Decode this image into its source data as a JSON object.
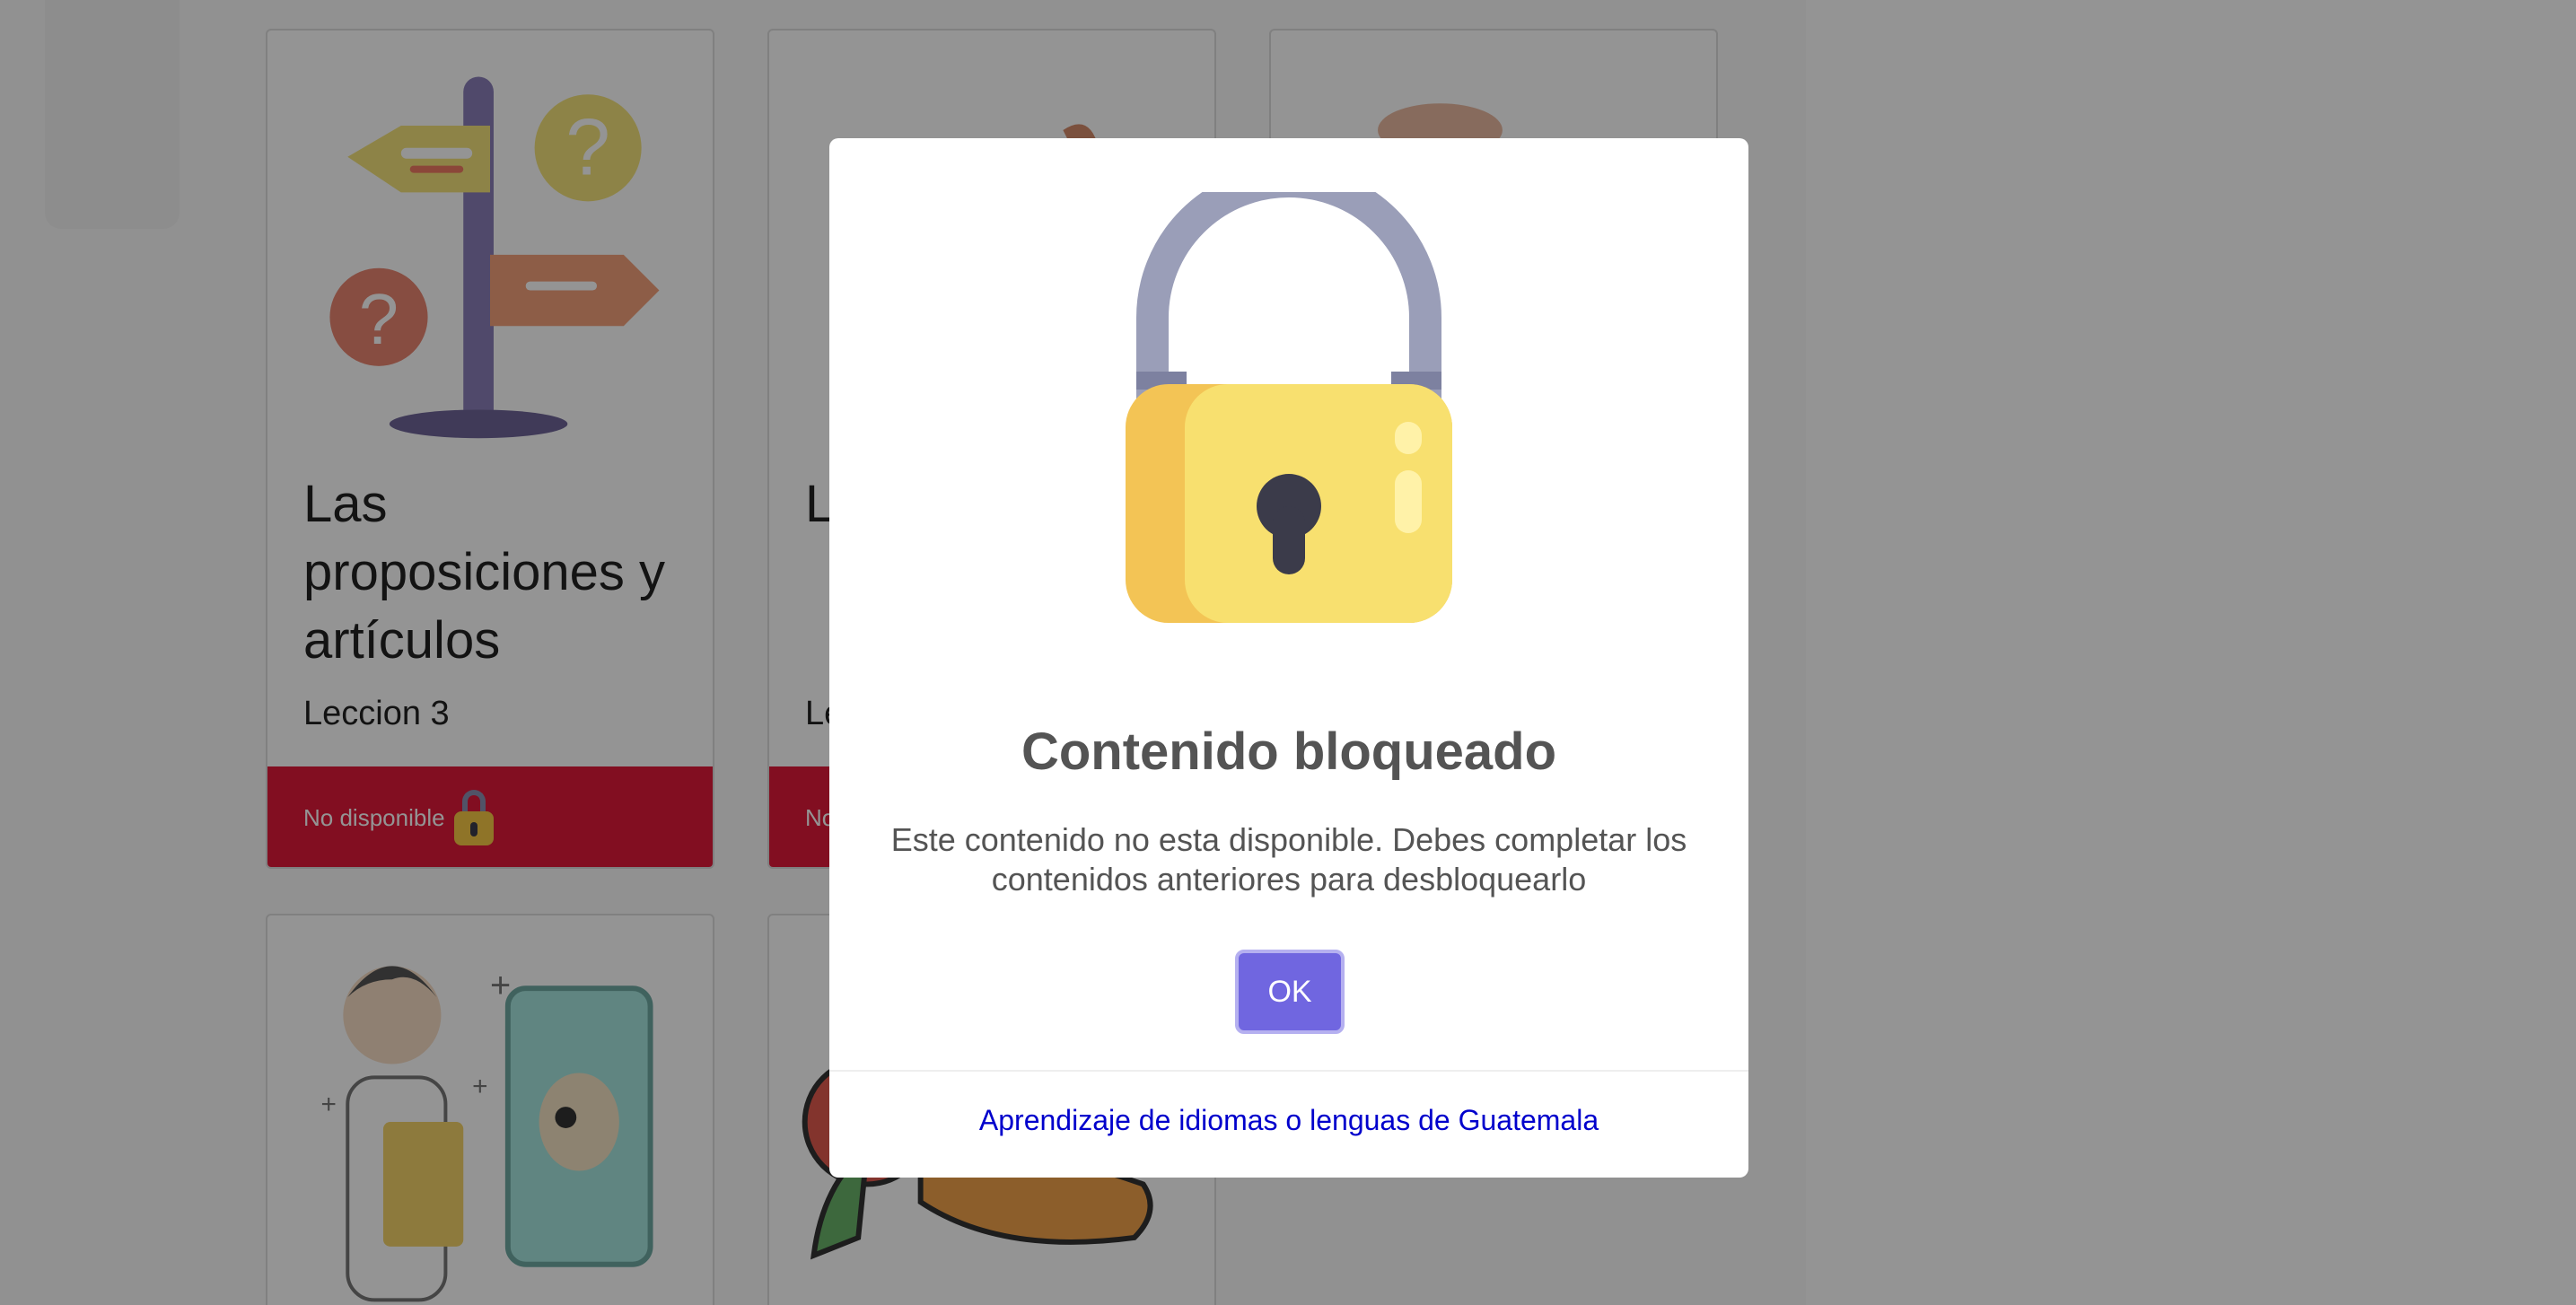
{
  "cards": [
    {
      "title": "Las proposiciones y artículos",
      "subtitle": "Leccion 3",
      "status": "No disponible",
      "status_icon": "lock-icon"
    },
    {
      "title": "L c",
      "subtitle": "Le",
      "status": "No",
      "status_icon": "lock-icon"
    }
  ],
  "modal": {
    "icon": "padlock-icon",
    "title": "Contenido bloqueado",
    "text": "Este contenido no esta disponible. Debes completar los contenidos anteriores para desbloquearlo",
    "ok_label": "OK",
    "footer_link": "Aprendizaje de idiomas o lenguas de Guatemala"
  },
  "colors": {
    "overlay": "#000000",
    "card_footer": "#e0193a",
    "ok_button": "#7066e0",
    "footer_link": "#0000cc",
    "lock_body": "#f8d96a",
    "lock_shackle": "#9a9eb8"
  }
}
